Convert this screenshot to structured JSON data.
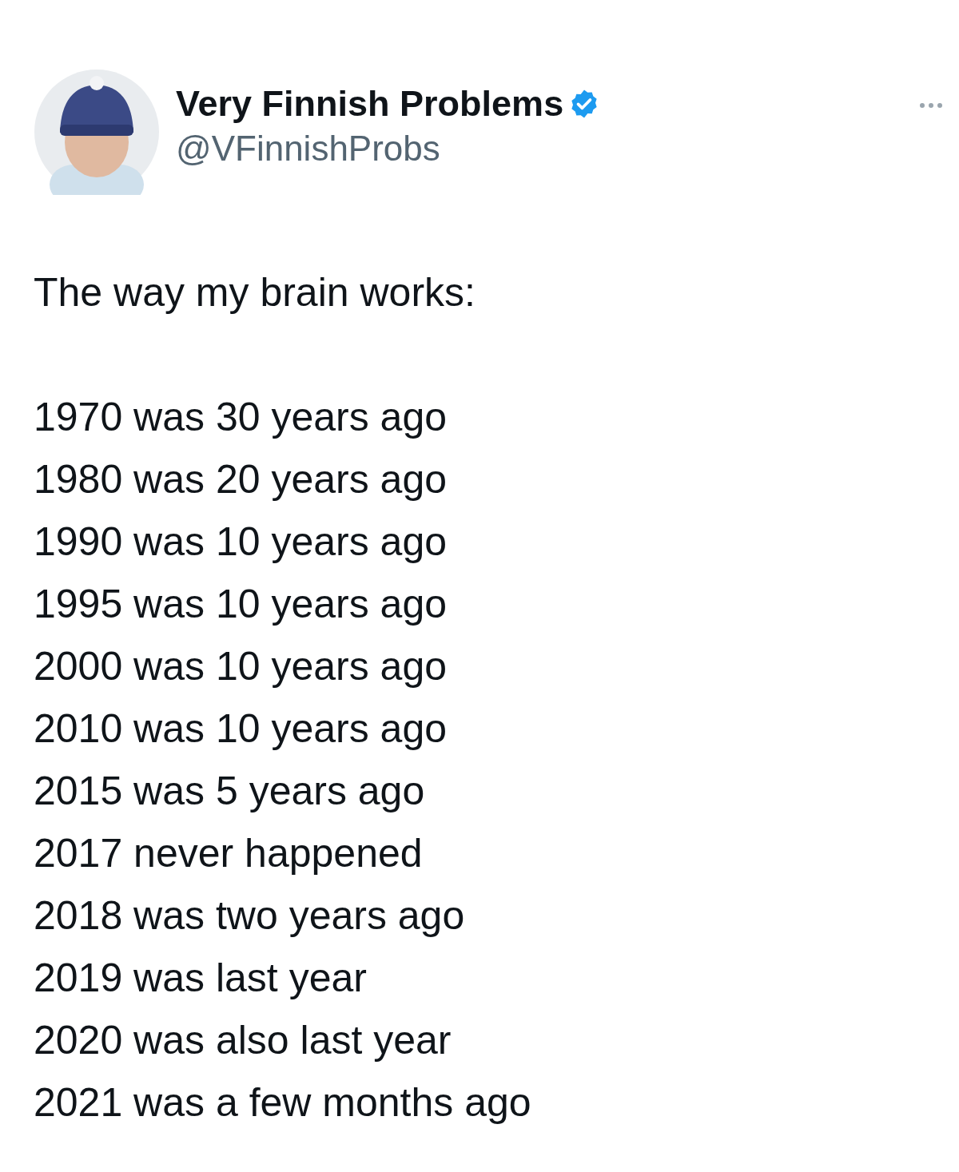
{
  "author": {
    "name": "Very Finnish Problems",
    "verified": true,
    "handle": "@VFinnishProbs"
  },
  "tweet": {
    "intro": "The way my brain works:",
    "lines": [
      "1970 was 30 years ago",
      "1980 was 20 years ago",
      "1990 was 10 years ago",
      "1995 was 10 years ago",
      "2000 was 10 years ago",
      "2010 was 10 years ago",
      "2015 was 5 years ago",
      "2017 never happened",
      "2018 was two years ago",
      "2019 was last year",
      "2020 was also last year",
      "2021 was a few months ago"
    ]
  }
}
